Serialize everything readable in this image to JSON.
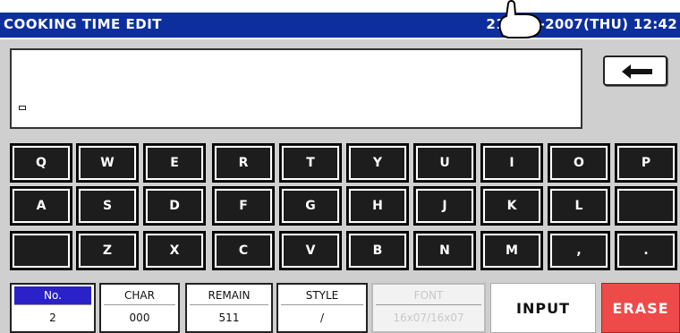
{
  "title": "COOKING TIME EDIT",
  "datetime": "21-JUN-2007(THU)  12:42",
  "keyboard": {
    "row1": [
      "Q",
      "W",
      "E",
      "R",
      "T",
      "Y",
      "U",
      "I",
      "O",
      "P"
    ],
    "row2": [
      "A",
      "S",
      "D",
      "F",
      "G",
      "H",
      "J",
      "K",
      "L",
      ""
    ],
    "row3": [
      "",
      "Z",
      "X",
      "C",
      "V",
      "B",
      "N",
      "M",
      ",",
      "."
    ]
  },
  "status": {
    "no_label": "No.",
    "no_value": "2",
    "char_label": "CHAR",
    "char_value": "000",
    "remain_label": "REMAIN",
    "remain_value": "511",
    "style_label": "STYLE",
    "style_value": "/",
    "font_label": "FONT",
    "font_value": "16x07/16x07"
  },
  "buttons": {
    "input": "INPUT",
    "erase": "ERASE"
  },
  "icons": {
    "back": "back-arrow-icon",
    "pointer": "finger-pointer-icon"
  },
  "colors": {
    "title_bg": "#0d2f9e",
    "selected": "#2a22c8",
    "erase": "#ef4a4a"
  }
}
